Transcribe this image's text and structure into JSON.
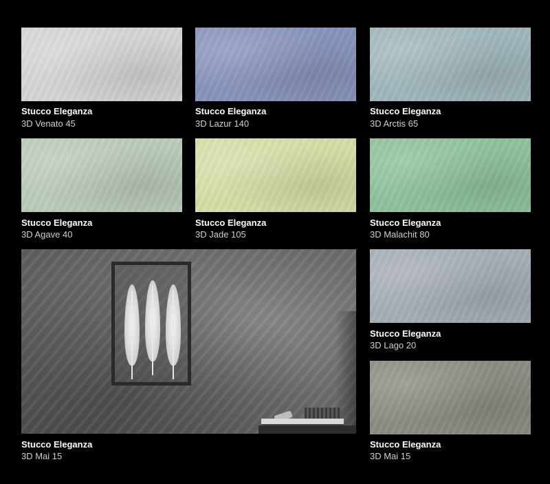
{
  "swatches": [
    {
      "name": "Stucco Eleganza",
      "code": "3D Venato 45",
      "color": "#d6d6d4"
    },
    {
      "name": "Stucco Eleganza",
      "code": "3D Lazur 140",
      "color": "#8995bd"
    },
    {
      "name": "Stucco Eleganza",
      "code": "3D Arctis 65",
      "color": "#a1b8bd"
    },
    {
      "name": "Stucco Eleganza",
      "code": "3D Agave 40",
      "color": "#bccbbb"
    },
    {
      "name": "Stucco Eleganza",
      "code": "3D Jade 105",
      "color": "#d5e0a7"
    },
    {
      "name": "Stucco Eleganza",
      "code": "3D Malachit 80",
      "color": "#8fc39c"
    },
    {
      "name": "Stucco Eleganza",
      "code": "3D Lago 20",
      "color": "#a7aeb6"
    },
    {
      "name": "Stucco Eleganza",
      "code": "3D Mai 15",
      "color": "#8d8d85"
    }
  ],
  "photo": {
    "name": "Stucco Eleganza",
    "code": "3D Mai 15"
  }
}
